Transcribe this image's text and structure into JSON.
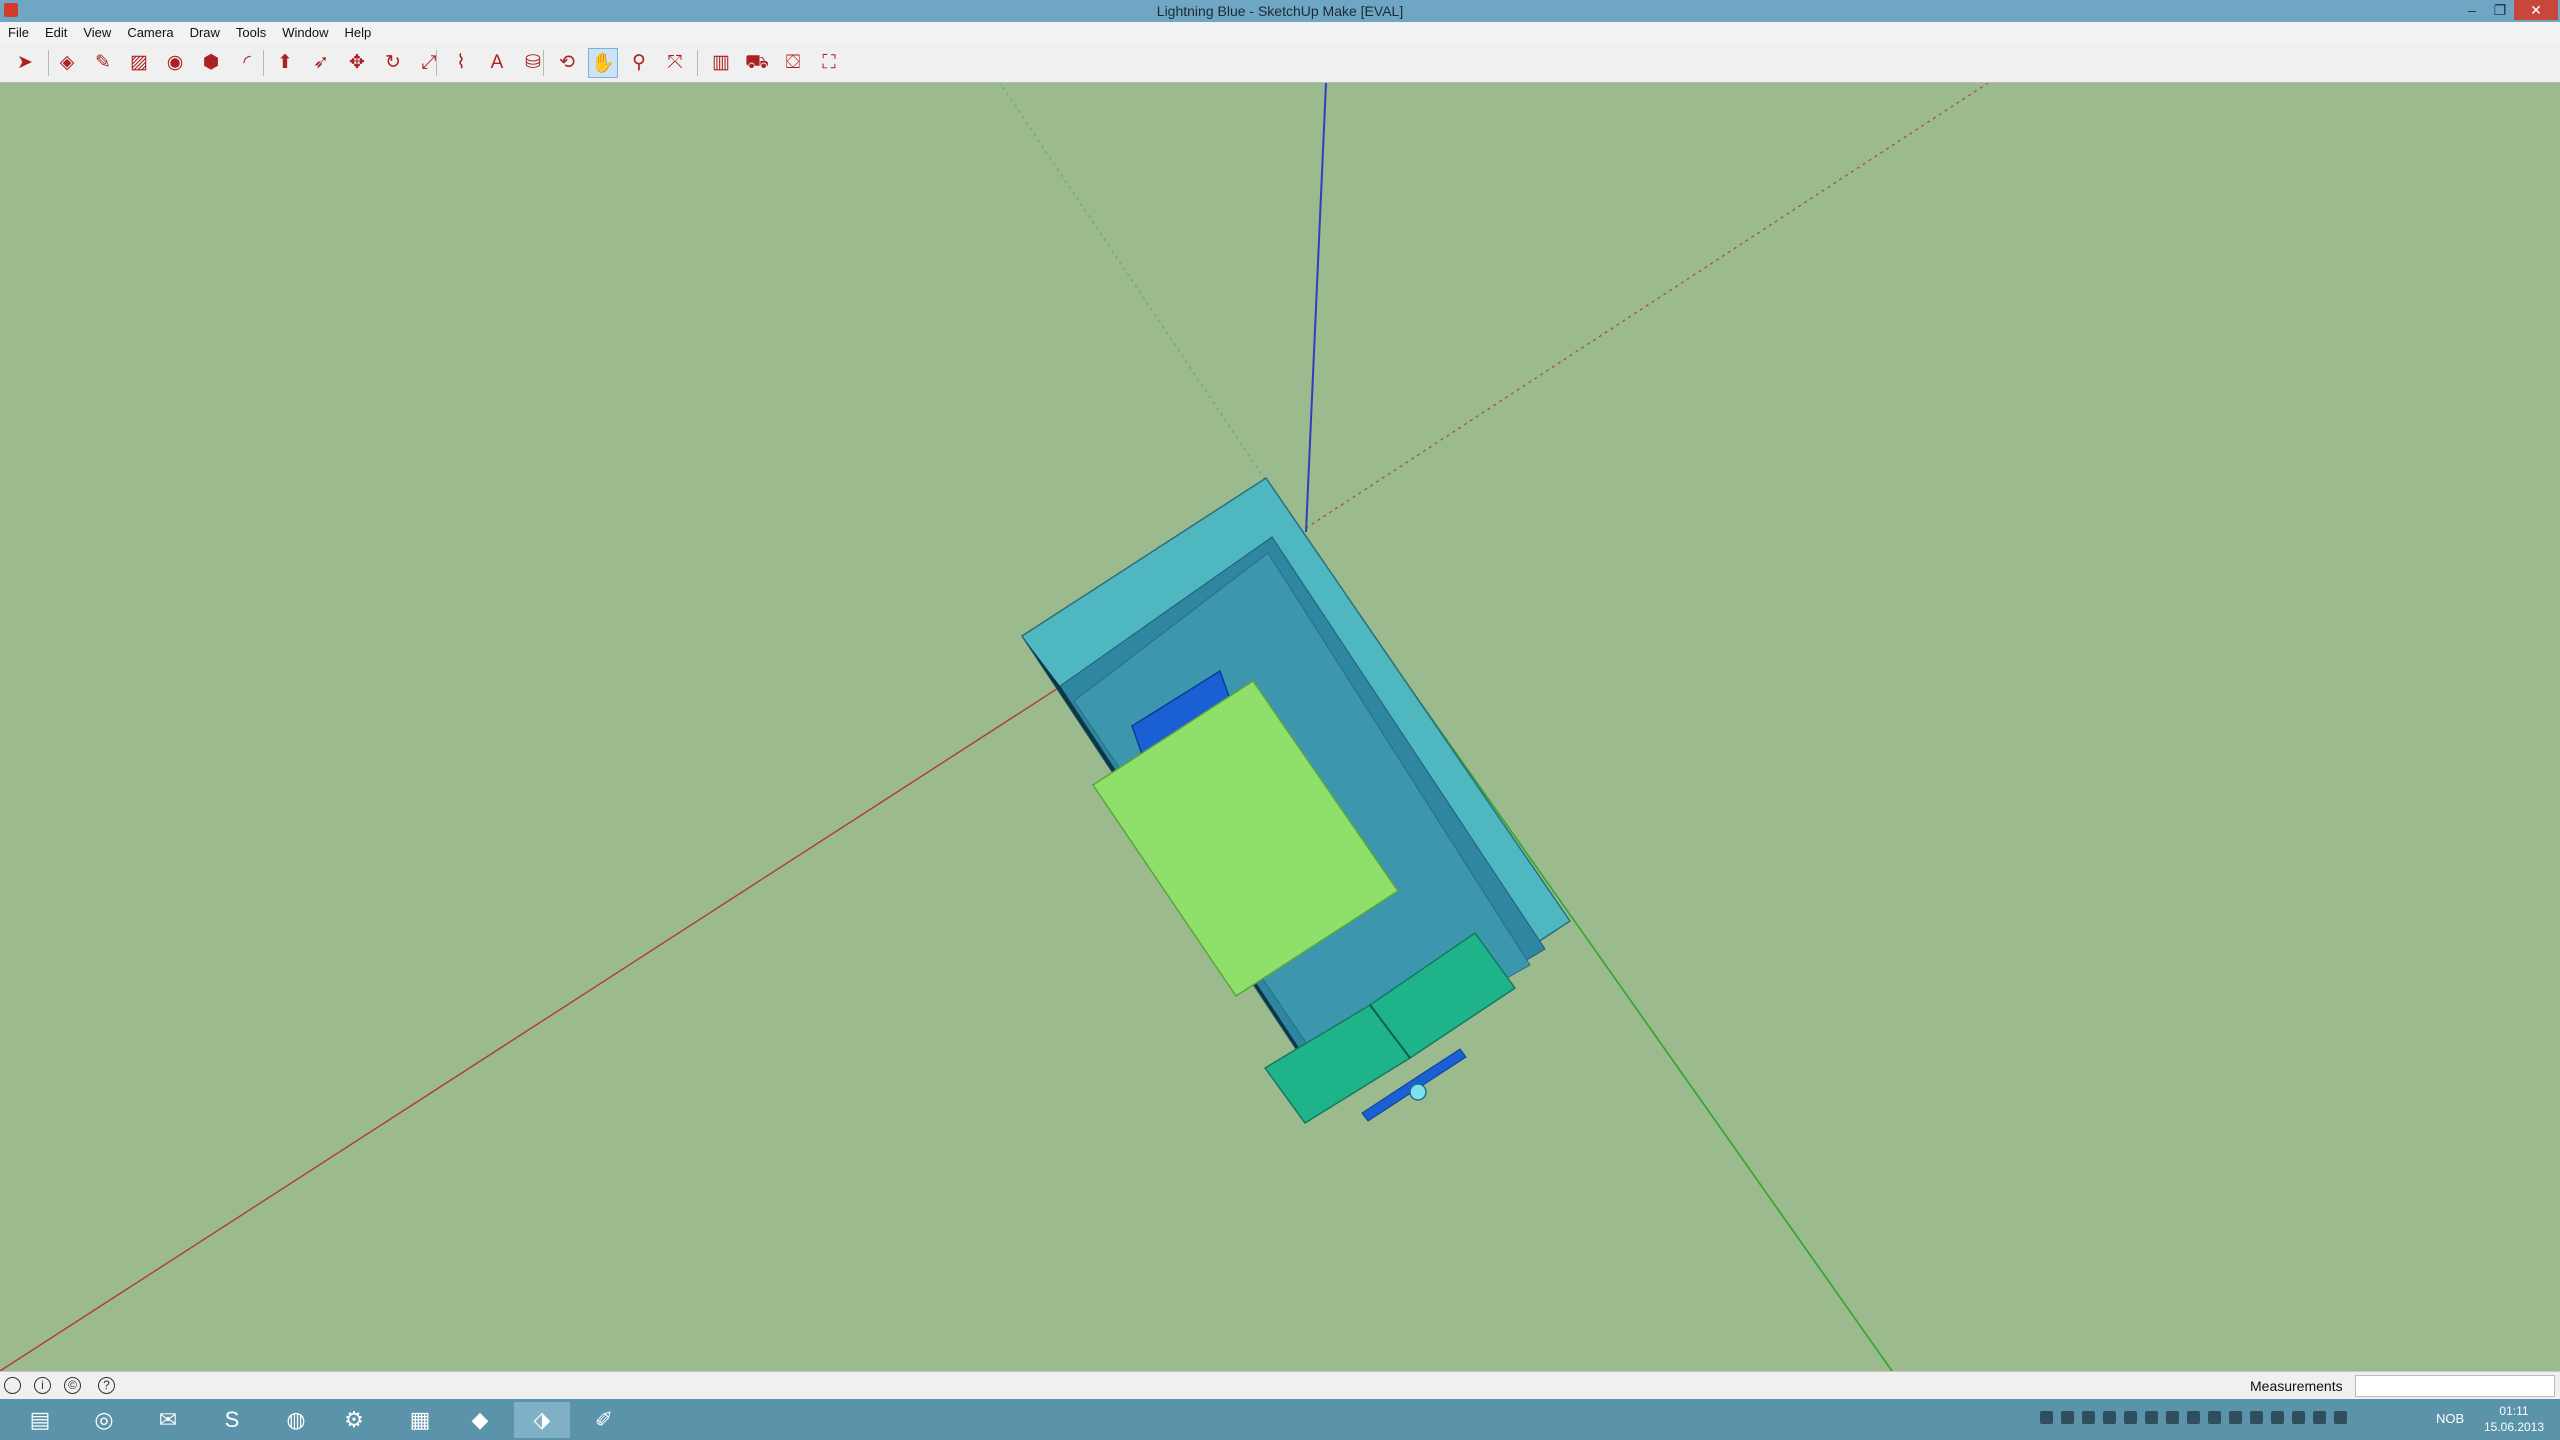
{
  "window": {
    "title": "Lightning Blue - SketchUp Make [EVAL]",
    "minimize": "–",
    "restore": "❐",
    "close": "✕"
  },
  "menu": [
    "File",
    "Edit",
    "View",
    "Camera",
    "Draw",
    "Tools",
    "Window",
    "Help"
  ],
  "toolbar": {
    "tools": [
      {
        "name": "select-tool-icon",
        "glyph": "➤",
        "selected": false
      },
      {
        "name": "eraser-tool-icon",
        "glyph": "◈",
        "selected": false
      },
      {
        "name": "pencil-tool-icon",
        "glyph": "✎",
        "selected": false
      },
      {
        "name": "rectangle-tool-icon",
        "glyph": "▨",
        "selected": false
      },
      {
        "name": "circle-tool-icon",
        "glyph": "◉",
        "selected": false
      },
      {
        "name": "polygon-tool-icon",
        "glyph": "⬢",
        "selected": false
      },
      {
        "name": "arc-tool-icon",
        "glyph": "◜",
        "selected": false
      },
      {
        "name": "push-pull-tool-icon",
        "glyph": "⬆",
        "selected": false
      },
      {
        "name": "follow-me-tool-icon",
        "glyph": "➶",
        "selected": false
      },
      {
        "name": "move-tool-icon",
        "glyph": "✥",
        "selected": false
      },
      {
        "name": "rotate-tool-icon",
        "glyph": "↻",
        "selected": false
      },
      {
        "name": "scale-tool-icon",
        "glyph": "⤢",
        "selected": false
      },
      {
        "name": "tape-measure-tool-icon",
        "glyph": "⌇",
        "selected": false
      },
      {
        "name": "text-tool-icon",
        "glyph": "A",
        "selected": false
      },
      {
        "name": "paint-bucket-tool-icon",
        "glyph": "⛁",
        "selected": false
      },
      {
        "name": "orbit-tool-icon",
        "glyph": "⟲",
        "selected": false
      },
      {
        "name": "pan-tool-icon",
        "glyph": "✋",
        "selected": true
      },
      {
        "name": "zoom-tool-icon",
        "glyph": "⚲",
        "selected": false
      },
      {
        "name": "zoom-extents-tool-icon",
        "glyph": "⤧",
        "selected": false
      },
      {
        "name": "warehouse-icon",
        "glyph": "▥",
        "selected": false
      },
      {
        "name": "share-model-icon",
        "glyph": "⛟",
        "selected": false
      },
      {
        "name": "get-models-icon",
        "glyph": "⛋",
        "selected": false
      },
      {
        "name": "extension-warehouse-icon",
        "glyph": "⛶",
        "selected": false
      }
    ]
  },
  "status": {
    "measurements_label": "Measurements",
    "measurements_value": ""
  },
  "taskbar": {
    "apps": [
      {
        "name": "file-explorer-icon",
        "glyph": "▤",
        "active": false
      },
      {
        "name": "chrome-icon",
        "glyph": "◎",
        "active": false
      },
      {
        "name": "thunderbird-icon",
        "glyph": "✉",
        "active": false
      },
      {
        "name": "skype-icon",
        "glyph": "S",
        "active": false
      },
      {
        "name": "origin-icon",
        "glyph": "◍",
        "active": false
      },
      {
        "name": "steam-icon",
        "glyph": "⚙",
        "active": false
      },
      {
        "name": "app-icon",
        "glyph": "▦",
        "active": false
      },
      {
        "name": "app-icon-2",
        "glyph": "◆",
        "active": false
      },
      {
        "name": "sketchup-icon",
        "glyph": "⬗",
        "active": true
      },
      {
        "name": "paint-icon",
        "glyph": "✐",
        "active": false
      }
    ],
    "language": "NOB",
    "time": "01:11",
    "date": "15.06.2013"
  },
  "colors": {
    "sky": "#9bba8d",
    "box_outer": "#4fb7c0",
    "box_inner": "#3c97ae",
    "bed": "#8fe06a",
    "cushion": "#1a5fd4",
    "cabinet": "#1fb389",
    "red_axis": "#b23a3a",
    "green_axis": "#2da82d",
    "blue_axis": "#2e3fbf"
  }
}
